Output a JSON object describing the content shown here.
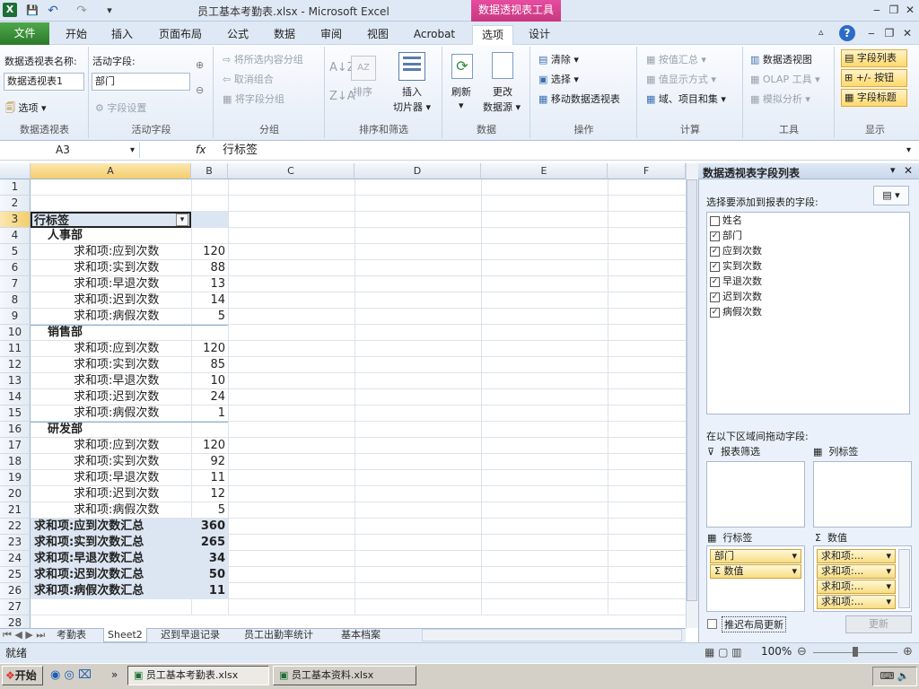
{
  "window": {
    "title": "员工基本考勤表.xlsx - Microsoft Excel",
    "context_tab": "数据透视表工具"
  },
  "qat": {
    "save": "💾",
    "undo": "↶",
    "redo": "↷"
  },
  "tabs": {
    "file": "文件",
    "items": [
      "开始",
      "插入",
      "页面布局",
      "公式",
      "数据",
      "审阅",
      "视图",
      "Acrobat",
      "选项",
      "设计"
    ]
  },
  "ribbon": {
    "pt_name_label": "数据透视表名称:",
    "pt_name_value": "数据透视表1",
    "options": "选项",
    "active_field_label": "活动字段:",
    "active_field_value": "部门",
    "field_settings": "字段设置",
    "g_pivot": "数据透视表",
    "g_active": "活动字段",
    "group_selection": "将所选内容分组",
    "ungroup": "取消组合",
    "group_field": "将字段分组",
    "g_group": "分组",
    "sort": "排序",
    "insert_slicer_1": "插入",
    "insert_slicer_2": "切片器",
    "g_sort": "排序和筛选",
    "refresh": "刷新",
    "change_source_1": "更改",
    "change_source_2": "数据源",
    "g_data": "数据",
    "clear": "清除",
    "select": "选择",
    "move": "移动数据透视表",
    "g_actions": "操作",
    "summarize": "按值汇总",
    "show_values": "值显示方式",
    "fields_items": "域、项目和集",
    "g_calc": "计算",
    "pivotchart": "数据透视图",
    "olap": "OLAP 工具",
    "whatif": "模拟分析",
    "g_tools": "工具",
    "field_list": "字段列表",
    "buttons": "+/- 按钮",
    "headers": "字段标题",
    "g_show": "显示"
  },
  "formula": {
    "name_box": "A3",
    "fx": "fx",
    "value": "行标签"
  },
  "columns": [
    "A",
    "B",
    "C",
    "D",
    "E",
    "F"
  ],
  "rows": [
    "1",
    "2",
    "3",
    "4",
    "5",
    "6",
    "7",
    "8",
    "9",
    "10",
    "11",
    "12",
    "13",
    "14",
    "15",
    "16",
    "17",
    "18",
    "19",
    "20",
    "21",
    "22",
    "23",
    "24",
    "25",
    "26",
    "27",
    "28"
  ],
  "cells": {
    "r3": "行标签",
    "r4": "人事部",
    "r5": [
      "求和项:应到次数",
      "120"
    ],
    "r6": [
      "求和项:实到次数",
      "88"
    ],
    "r7": [
      "求和项:早退次数",
      "13"
    ],
    "r8": [
      "求和项:迟到次数",
      "14"
    ],
    "r9": [
      "求和项:病假次数",
      "5"
    ],
    "r10": "销售部",
    "r11": [
      "求和项:应到次数",
      "120"
    ],
    "r12": [
      "求和项:实到次数",
      "85"
    ],
    "r13": [
      "求和项:早退次数",
      "10"
    ],
    "r14": [
      "求和项:迟到次数",
      "24"
    ],
    "r15": [
      "求和项:病假次数",
      "1"
    ],
    "r16": "研发部",
    "r17": [
      "求和项:应到次数",
      "120"
    ],
    "r18": [
      "求和项:实到次数",
      "92"
    ],
    "r19": [
      "求和项:早退次数",
      "11"
    ],
    "r20": [
      "求和项:迟到次数",
      "12"
    ],
    "r21": [
      "求和项:病假次数",
      "5"
    ],
    "r22": [
      "求和项:应到次数汇总",
      "360"
    ],
    "r23": [
      "求和项:实到次数汇总",
      "265"
    ],
    "r24": [
      "求和项:早退次数汇总",
      "34"
    ],
    "r25": [
      "求和项:迟到次数汇总",
      "50"
    ],
    "r26": [
      "求和项:病假次数汇总",
      "11"
    ]
  },
  "sheets": [
    "考勤表",
    "Sheet2",
    "迟到早退记录",
    "员工出勤率统计",
    "基本档案"
  ],
  "status": {
    "ready": "就绪",
    "zoom": "100%"
  },
  "panel": {
    "title": "数据透视表字段列表",
    "choose": "选择要添加到报表的字段:",
    "fields": [
      {
        "name": "姓名",
        "checked": false
      },
      {
        "name": "部门",
        "checked": true
      },
      {
        "name": "应到次数",
        "checked": true
      },
      {
        "name": "实到次数",
        "checked": true
      },
      {
        "name": "早退次数",
        "checked": true
      },
      {
        "name": "迟到次数",
        "checked": true
      },
      {
        "name": "病假次数",
        "checked": true
      }
    ],
    "drag_label": "在以下区域间拖动字段:",
    "report_filter": "报表筛选",
    "col_labels": "列标签",
    "row_labels": "行标签",
    "values": "数值",
    "row_items": [
      "部门",
      "Σ 数值"
    ],
    "value_items": [
      "求和项:...",
      "求和项:...",
      "求和项:...",
      "求和项:..."
    ],
    "defer": "推迟布局更新",
    "update": "更新"
  },
  "taskbar": {
    "start": "开始",
    "items": [
      "员工基本考勤表.xlsx",
      "员工基本资料.xlsx"
    ]
  },
  "colors": {
    "accent": "#c8377f",
    "file_green": "#2b7a2a",
    "pivot_blue": "#dce6f2"
  }
}
